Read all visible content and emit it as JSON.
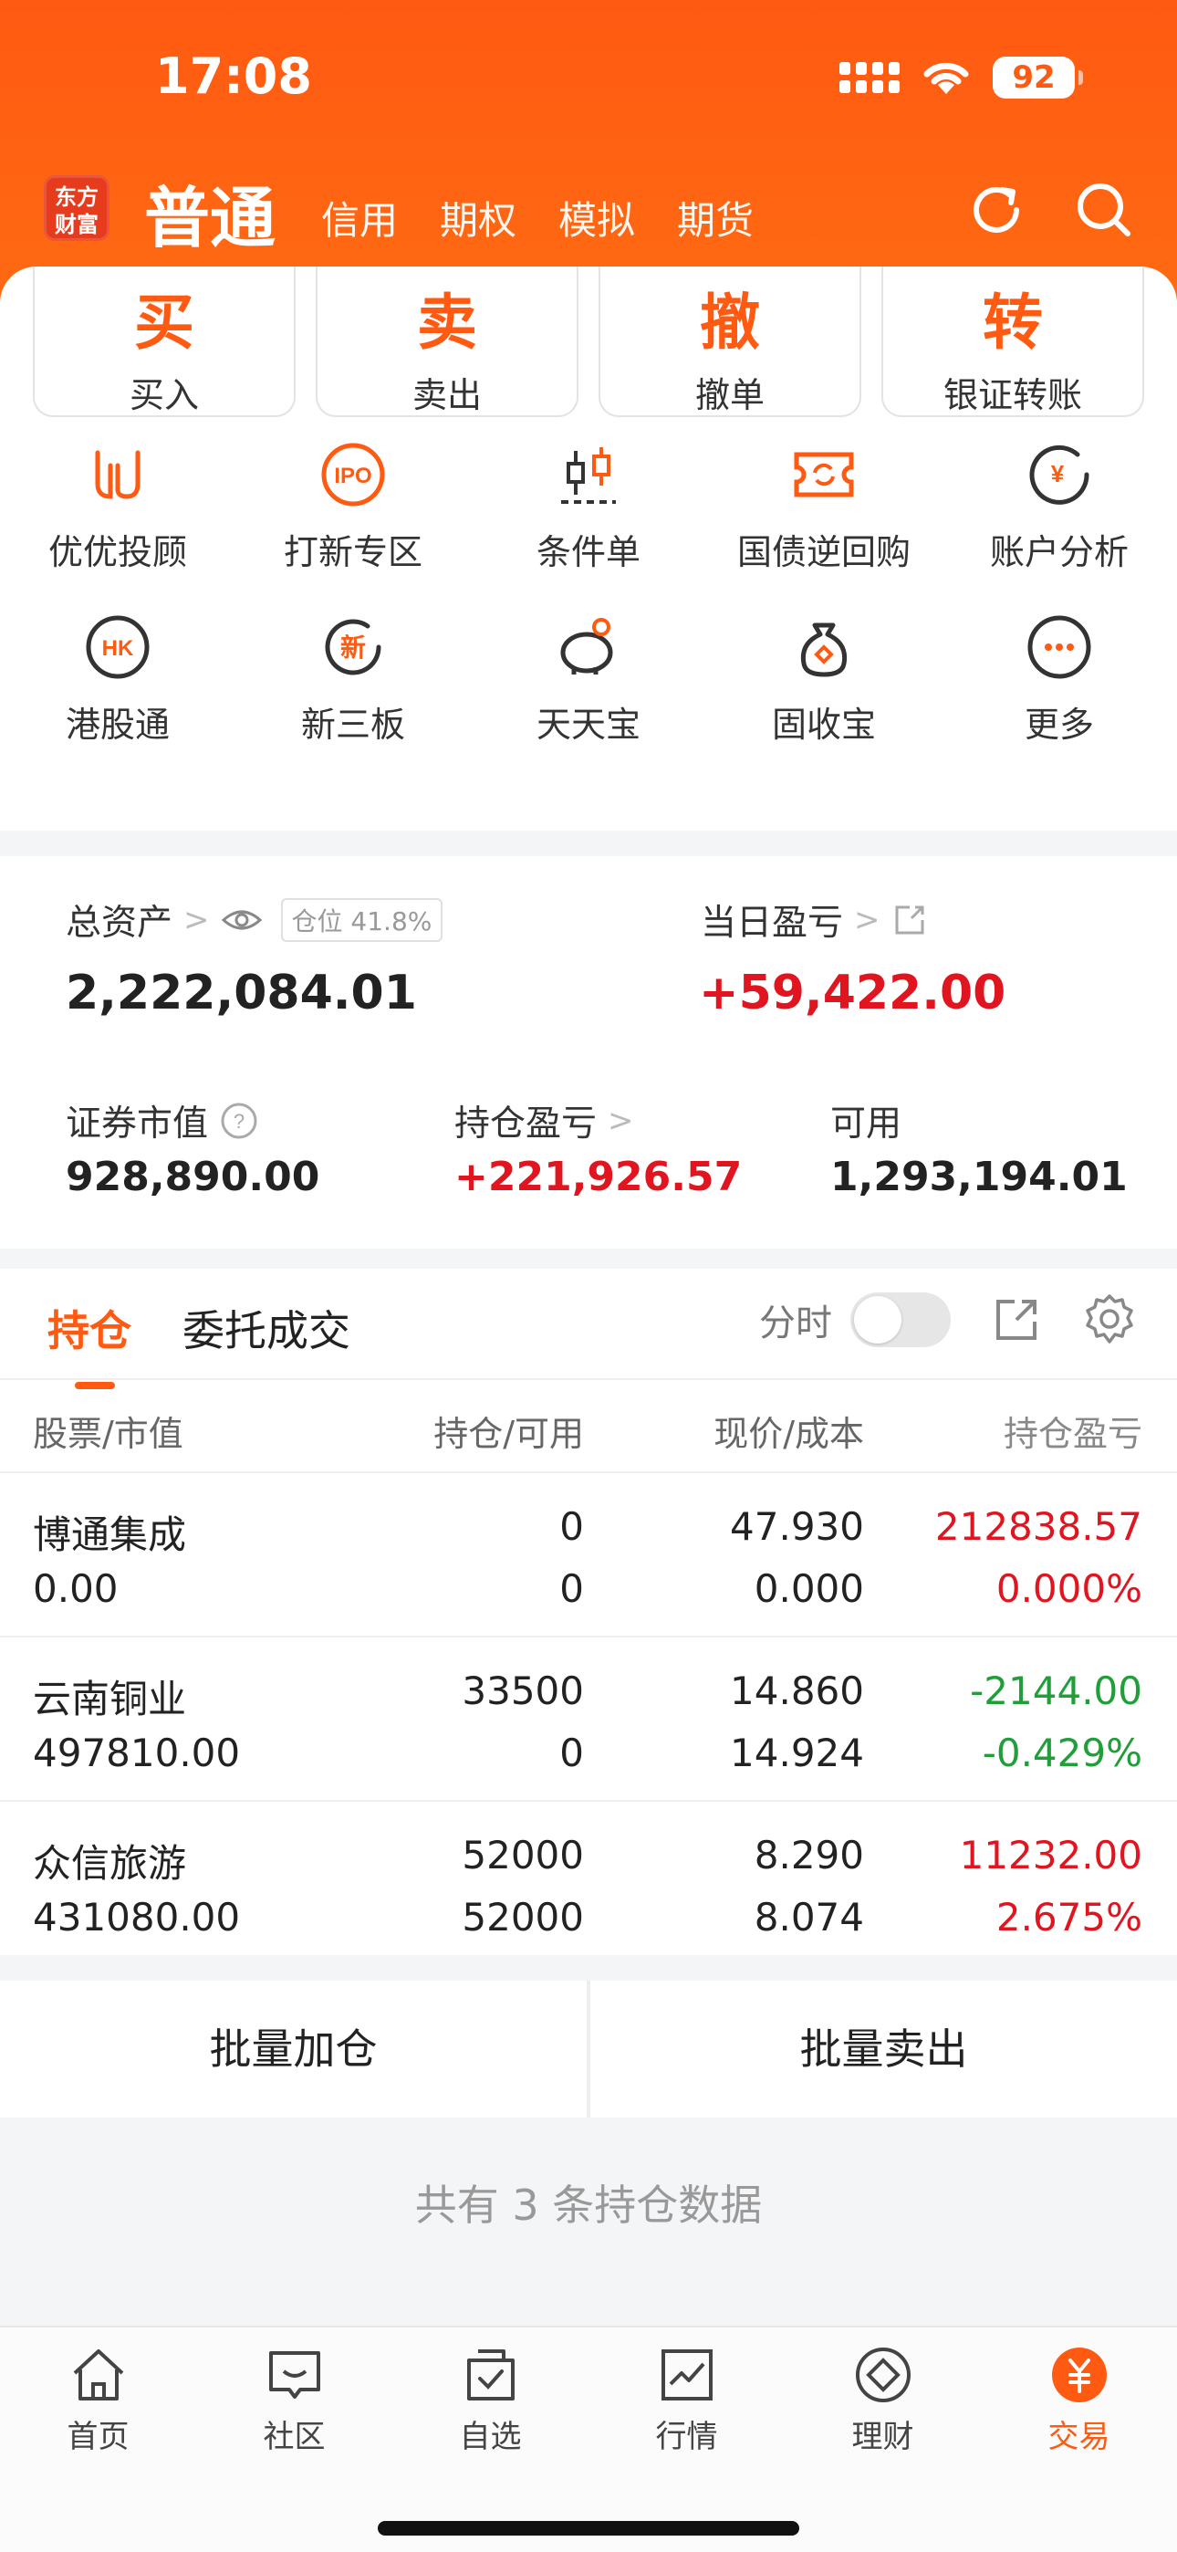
{
  "status_bar": {
    "time": "17:08",
    "battery": "92"
  },
  "header": {
    "logo_line1": "东方",
    "logo_line2": "财富",
    "main_tab": "普通",
    "tabs": [
      "信用",
      "期权",
      "模拟",
      "期货"
    ],
    "accent": "#ff5a12"
  },
  "trade_buttons": [
    {
      "char": "买",
      "label": "买入"
    },
    {
      "char": "卖",
      "label": "卖出"
    },
    {
      "char": "撤",
      "label": "撤单"
    },
    {
      "char": "转",
      "label": "银证转账"
    }
  ],
  "grid": [
    {
      "icon": "advisor-icon",
      "label": "优优投顾"
    },
    {
      "icon": "ipo-icon",
      "label": "打新专区",
      "text": "IPO"
    },
    {
      "icon": "conditional-order-icon",
      "label": "条件单"
    },
    {
      "icon": "reverse-repo-icon",
      "label": "国债逆回购"
    },
    {
      "icon": "account-analysis-icon",
      "label": "账户分析",
      "text": "¥"
    },
    {
      "icon": "hk-connect-icon",
      "label": "港股通",
      "text": "HK"
    },
    {
      "icon": "new-third-board-icon",
      "label": "新三板",
      "text": "新"
    },
    {
      "icon": "piggy-bank-icon",
      "label": "天天宝"
    },
    {
      "icon": "money-bag-icon",
      "label": "固收宝"
    },
    {
      "icon": "more-icon",
      "label": "更多"
    }
  ],
  "assets": {
    "total_label": "总资产",
    "position_badge": "仓位 41.8%",
    "total_value": "2,222,084.01",
    "daily_pnl_label": "当日盈亏",
    "daily_pnl_value": "+59,422.00",
    "market_value_label": "证券市值",
    "market_value": "928,890.00",
    "holding_pnl_label": "持仓盈亏",
    "holding_pnl": "+221,926.57",
    "available_label": "可用",
    "available": "1,293,194.01"
  },
  "holdings": {
    "tab_active": "持仓",
    "tab_other": "委托成交",
    "toggle_label": "分时",
    "headers": [
      "股票/市值",
      "持仓/可用",
      "现价/成本",
      "持仓盈亏"
    ],
    "rows": [
      {
        "name": "博通集成",
        "value": "0.00",
        "hold": "0",
        "avail": "0",
        "price": "47.930",
        "cost": "0.000",
        "pnl": "212838.57",
        "pnl_pct": "0.000%",
        "sign": "up"
      },
      {
        "name": "云南铜业",
        "value": "497810.00",
        "hold": "33500",
        "avail": "0",
        "price": "14.860",
        "cost": "14.924",
        "pnl": "-2144.00",
        "pnl_pct": "-0.429%",
        "sign": "down"
      },
      {
        "name": "众信旅游",
        "value": "431080.00",
        "hold": "52000",
        "avail": "52000",
        "price": "8.290",
        "cost": "8.074",
        "pnl": "11232.00",
        "pnl_pct": "2.675%",
        "sign": "up"
      }
    ],
    "batch_add": "批量加仓",
    "batch_sell": "批量卖出",
    "count_text": "共有 3 条持仓数据"
  },
  "tabbar": [
    {
      "icon": "home-icon",
      "label": "首页"
    },
    {
      "icon": "community-icon",
      "label": "社区"
    },
    {
      "icon": "watchlist-icon",
      "label": "自选"
    },
    {
      "icon": "market-icon",
      "label": "行情"
    },
    {
      "icon": "wealth-icon",
      "label": "理财"
    },
    {
      "icon": "trade-icon",
      "label": "交易",
      "active": true
    }
  ]
}
